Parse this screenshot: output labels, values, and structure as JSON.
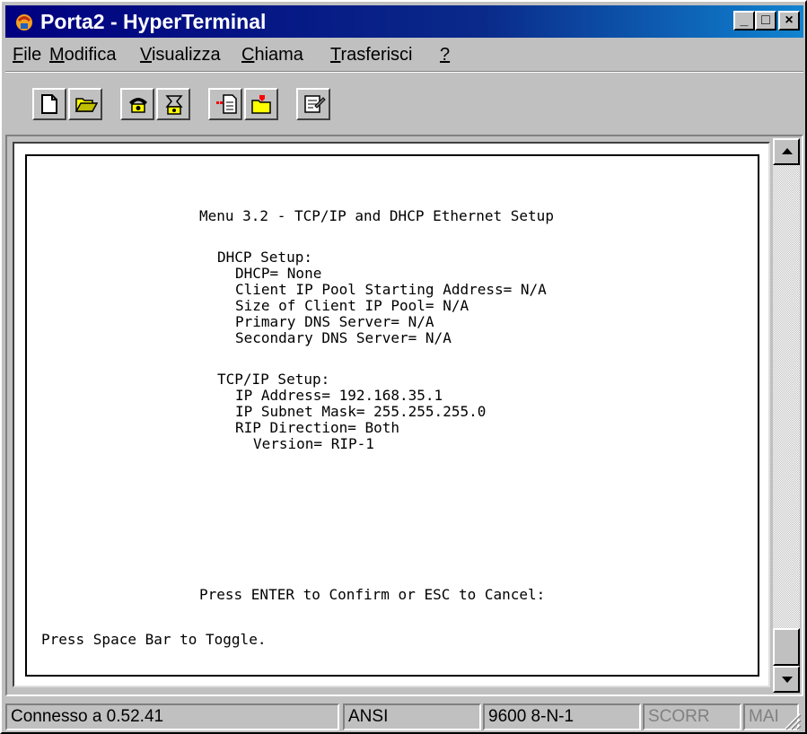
{
  "window": {
    "title": "Porta2 - HyperTerminal"
  },
  "title_buttons": {
    "minimize": "_",
    "maximize": "□",
    "close": "×"
  },
  "menubar": {
    "items": [
      {
        "pre": "",
        "key": "F",
        "rest": "ile"
      },
      {
        "pre": "",
        "key": "M",
        "rest": "odifica"
      },
      {
        "pre": "",
        "key": "V",
        "rest": "isualizza"
      },
      {
        "pre": "",
        "key": "C",
        "rest": "hiama"
      },
      {
        "pre": "",
        "key": "T",
        "rest": "rasferisci"
      },
      {
        "pre": "",
        "key": "?",
        "rest": ""
      }
    ]
  },
  "toolbar": {
    "icons": [
      "new-document-icon",
      "open-folder-icon",
      "connect-phone-icon",
      "disconnect-phone-icon",
      "send-file-icon",
      "receive-file-icon",
      "properties-icon"
    ]
  },
  "terminal": {
    "menu_title": "Menu 3.2 - TCP/IP and DHCP Ethernet Setup",
    "dhcp_header": "DHCP Setup:",
    "dhcp": "DHCP= None",
    "pool_start": "Client IP Pool Starting Address= N/A",
    "pool_size": "Size of Client IP Pool= N/A",
    "primary_dns": "Primary DNS Server= N/A",
    "secondary_dns": "Secondary DNS Server= N/A",
    "tcpip_header": "TCP/IP Setup:",
    "ip_address": "IP Address= 192.168.35.1",
    "subnet_mask": "IP Subnet Mask= 255.255.255.0",
    "rip_direction": "RIP Direction= Both",
    "version": "Version= RIP-1",
    "confirm_prompt": "Press ENTER to Confirm or ESC to Cancel:",
    "toggle_hint": "Press Space Bar to Toggle."
  },
  "statusbar": {
    "connection": "Connesso a 0.52.41",
    "emulation": "ANSI",
    "settings": "9600 8-N-1",
    "scroll": "SCORR",
    "caps": "MAI"
  },
  "colors": {
    "titlebar": "#000080",
    "face": "#c0c0c0",
    "terminal_bg": "#ffffff"
  }
}
